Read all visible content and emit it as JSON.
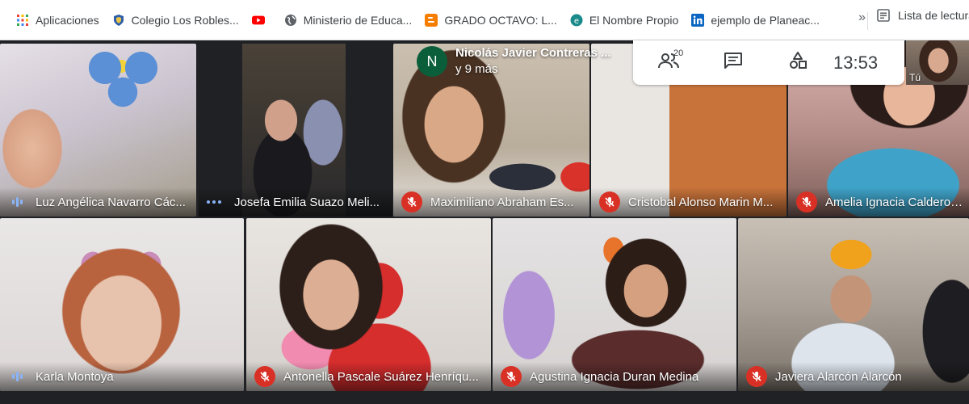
{
  "bookmarks": {
    "items": [
      {
        "label": "Aplicaciones",
        "icon": "apps-grid-icon"
      },
      {
        "label": "Colegio Los Robles...",
        "icon": "shield-crest-icon"
      },
      {
        "label": "",
        "icon": "youtube-icon"
      },
      {
        "label": "Ministerio de Educa...",
        "icon": "globe-icon"
      },
      {
        "label": "GRADO OCTAVO: L...",
        "icon": "blogger-icon"
      },
      {
        "label": "El Nombre Propio",
        "icon": "teal-logo-icon"
      },
      {
        "label": "ejemplo de Planeac...",
        "icon": "linkedin-icon"
      }
    ],
    "overflow": "»",
    "reading_list": "Lista de lectura"
  },
  "meeting": {
    "presenter": {
      "initial": "N",
      "line1": "Nicolás Javier Contreras ...",
      "line2": "y 9 más"
    },
    "participants_count": "20",
    "time": "13:53",
    "self_label": "Tú",
    "tiles": [
      {
        "name": "Luz Angélica Navarro Các...",
        "status": "speaking"
      },
      {
        "name": "Josefa Emilia Suazo Meli...",
        "status": "dots"
      },
      {
        "name": "Maximiliano Abraham Es...",
        "status": "muted"
      },
      {
        "name": "Cristobal Alonso Marin M...",
        "status": "muted"
      },
      {
        "name": "Amelia Ignacia Calderon ...",
        "status": "muted"
      },
      {
        "name": "Karla Montoya",
        "status": "speaking"
      },
      {
        "name": "Antonella Pascale Suárez Henríqu...",
        "status": "muted"
      },
      {
        "name": "Agustina Ignacia Duran Medina",
        "status": "muted"
      },
      {
        "name": "Javiera Alarcón Alarcón",
        "status": "muted"
      }
    ]
  },
  "colors": {
    "mute_red": "#d93025",
    "speak_blue": "#8ab4f8",
    "meet_bg": "#202124"
  }
}
